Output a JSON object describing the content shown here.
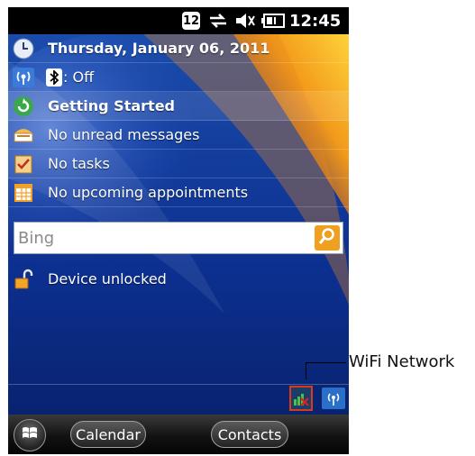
{
  "status_bar": {
    "notification_count": "12",
    "time": "12:45",
    "icons": [
      "notification-icon",
      "sync-icon",
      "volume-muted-icon",
      "battery-icon"
    ]
  },
  "today": {
    "date": "Thursday, January 06, 2011",
    "bluetooth": ": Off",
    "getting_started": "Getting Started",
    "messages": "No unread messages",
    "tasks": "No tasks",
    "appointments": "No upcoming appointments"
  },
  "search": {
    "placeholder": "Bing"
  },
  "lock": {
    "status": "Device unlocked"
  },
  "softkeys": {
    "left": "Calendar",
    "right": "Contacts"
  },
  "annotation": {
    "label": "WiFi Network"
  },
  "colors": {
    "status_bar": "#000000",
    "search_button": "#f0a020",
    "wifi_highlight": "#d93a1a"
  }
}
